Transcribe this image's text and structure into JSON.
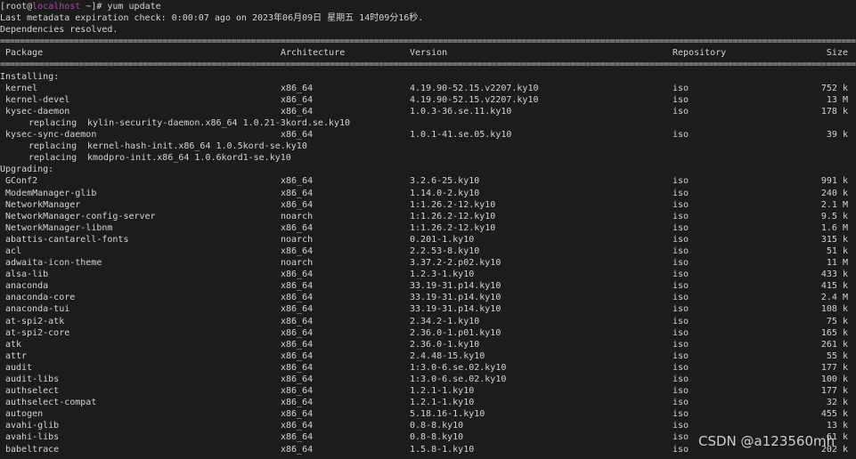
{
  "prompt": {
    "user": "root",
    "at": "@",
    "host": "localhost",
    "rest": " ~]# ",
    "open": "[",
    "command": "yum update"
  },
  "meta_line": "Last metadata expiration check: 0:00:07 ago on 2023年06月09日 星期五 14时09分16秒.",
  "deps_line": "Dependencies resolved.",
  "headers": {
    "package": "Package",
    "arch": "Architecture",
    "version": "Version",
    "repo": "Repository",
    "size": "Size"
  },
  "sections": [
    {
      "title": "Installing:",
      "rows": [
        {
          "pkg": "kernel",
          "arch": "x86_64",
          "ver": "4.19.90-52.15.v2207.ky10",
          "repo": "iso",
          "size": "752 k"
        },
        {
          "pkg": "kernel-devel",
          "arch": "x86_64",
          "ver": "4.19.90-52.15.v2207.ky10",
          "repo": "iso",
          "size": "13 M"
        },
        {
          "pkg": "kysec-daemon",
          "arch": "x86_64",
          "ver": "1.0.3-36.se.11.ky10",
          "repo": "iso",
          "size": "178 k",
          "replacing": [
            {
              "label": "replacing",
              "name": "kylin-security-daemon.x86_64 1.0.21-3kord.se.ky10"
            }
          ]
        },
        {
          "pkg": "kysec-sync-daemon",
          "arch": "x86_64",
          "ver": "1.0.1-41.se.05.ky10",
          "repo": "iso",
          "size": "39 k",
          "replacing": [
            {
              "label": "replacing",
              "name": "kernel-hash-init.x86_64 1.0.5kord-se.ky10"
            },
            {
              "label": "replacing",
              "name": "kmodpro-init.x86_64 1.0.6kord1-se.ky10"
            }
          ]
        }
      ]
    },
    {
      "title": "Upgrading:",
      "rows": [
        {
          "pkg": "GConf2",
          "arch": "x86_64",
          "ver": "3.2.6-25.ky10",
          "repo": "iso",
          "size": "991 k"
        },
        {
          "pkg": "ModemManager-glib",
          "arch": "x86_64",
          "ver": "1.14.0-2.ky10",
          "repo": "iso",
          "size": "240 k"
        },
        {
          "pkg": "NetworkManager",
          "arch": "x86_64",
          "ver": "1:1.26.2-12.ky10",
          "repo": "iso",
          "size": "2.1 M"
        },
        {
          "pkg": "NetworkManager-config-server",
          "arch": "noarch",
          "ver": "1:1.26.2-12.ky10",
          "repo": "iso",
          "size": "9.5 k"
        },
        {
          "pkg": "NetworkManager-libnm",
          "arch": "x86_64",
          "ver": "1:1.26.2-12.ky10",
          "repo": "iso",
          "size": "1.6 M"
        },
        {
          "pkg": "abattis-cantarell-fonts",
          "arch": "noarch",
          "ver": "0.201-1.ky10",
          "repo": "iso",
          "size": "315 k"
        },
        {
          "pkg": "acl",
          "arch": "x86_64",
          "ver": "2.2.53-8.ky10",
          "repo": "iso",
          "size": "51 k"
        },
        {
          "pkg": "adwaita-icon-theme",
          "arch": "noarch",
          "ver": "3.37.2-2.p02.ky10",
          "repo": "iso",
          "size": "11 M"
        },
        {
          "pkg": "alsa-lib",
          "arch": "x86_64",
          "ver": "1.2.3-1.ky10",
          "repo": "iso",
          "size": "433 k"
        },
        {
          "pkg": "anaconda",
          "arch": "x86_64",
          "ver": "33.19-31.p14.ky10",
          "repo": "iso",
          "size": "415 k"
        },
        {
          "pkg": "anaconda-core",
          "arch": "x86_64",
          "ver": "33.19-31.p14.ky10",
          "repo": "iso",
          "size": "2.4 M"
        },
        {
          "pkg": "anaconda-tui",
          "arch": "x86_64",
          "ver": "33.19-31.p14.ky10",
          "repo": "iso",
          "size": "108 k"
        },
        {
          "pkg": "at-spi2-atk",
          "arch": "x86_64",
          "ver": "2.34.2-1.ky10",
          "repo": "iso",
          "size": "75 k"
        },
        {
          "pkg": "at-spi2-core",
          "arch": "x86_64",
          "ver": "2.36.0-1.p01.ky10",
          "repo": "iso",
          "size": "165 k"
        },
        {
          "pkg": "atk",
          "arch": "x86_64",
          "ver": "2.36.0-1.ky10",
          "repo": "iso",
          "size": "261 k"
        },
        {
          "pkg": "attr",
          "arch": "x86_64",
          "ver": "2.4.48-15.ky10",
          "repo": "iso",
          "size": "55 k"
        },
        {
          "pkg": "audit",
          "arch": "x86_64",
          "ver": "1:3.0-6.se.02.ky10",
          "repo": "iso",
          "size": "177 k"
        },
        {
          "pkg": "audit-libs",
          "arch": "x86_64",
          "ver": "1:3.0-6.se.02.ky10",
          "repo": "iso",
          "size": "100 k"
        },
        {
          "pkg": "authselect",
          "arch": "x86_64",
          "ver": "1.2.1-1.ky10",
          "repo": "iso",
          "size": "177 k"
        },
        {
          "pkg": "authselect-compat",
          "arch": "x86_64",
          "ver": "1.2.1-1.ky10",
          "repo": "iso",
          "size": "32 k"
        },
        {
          "pkg": "autogen",
          "arch": "x86_64",
          "ver": "5.18.16-1.ky10",
          "repo": "iso",
          "size": "455 k"
        },
        {
          "pkg": "avahi-glib",
          "arch": "x86_64",
          "ver": "0.8-8.ky10",
          "repo": "iso",
          "size": "13 k"
        },
        {
          "pkg": "avahi-libs",
          "arch": "x86_64",
          "ver": "0.8-8.ky10",
          "repo": "iso",
          "size": "61 k"
        },
        {
          "pkg": "babeltrace",
          "arch": "x86_64",
          "ver": "1.5.8-1.ky10",
          "repo": "iso",
          "size": "202 k"
        }
      ]
    }
  ],
  "watermark": "CSDN @a123560mh"
}
